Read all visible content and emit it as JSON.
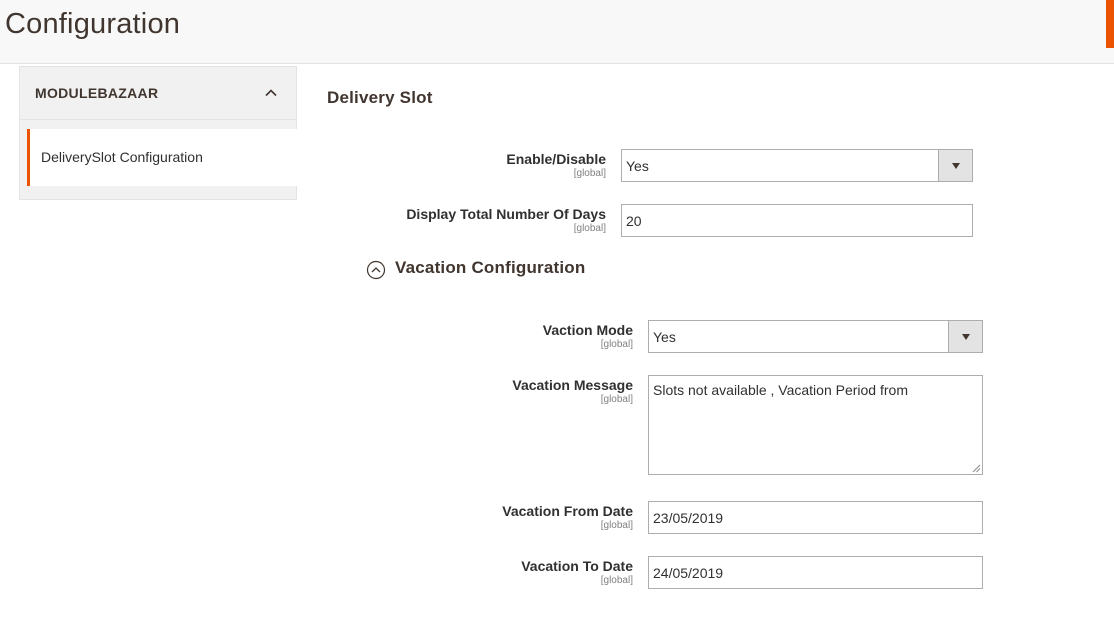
{
  "header": {
    "title": "Configuration"
  },
  "colors": {
    "accent": "#eb5202",
    "header_bg": "#f8f8f8",
    "sidebar_bg": "#f1f1f1"
  },
  "sidebar": {
    "section_label": "MODULEBAZAAR",
    "items": [
      {
        "label": "DeliverySlot Configuration",
        "active": true
      }
    ]
  },
  "main": {
    "section_title": "Delivery Slot",
    "fields": {
      "enable": {
        "label": "Enable/Disable",
        "scope": "[global]",
        "value": "Yes"
      },
      "total_days": {
        "label": "Display Total Number Of Days",
        "scope": "[global]",
        "value": "20"
      }
    },
    "vacation": {
      "group_title": "Vacation Configuration",
      "mode": {
        "label": "Vaction Mode",
        "scope": "[global]",
        "value": "Yes"
      },
      "message": {
        "label": "Vacation Message",
        "scope": "[global]",
        "value": "Slots not available , Vacation Period from"
      },
      "from_date": {
        "label": "Vacation From Date",
        "scope": "[global]",
        "value": "23/05/2019"
      },
      "to_date": {
        "label": "Vacation To Date",
        "scope": "[global]",
        "value": "24/05/2019"
      }
    }
  }
}
